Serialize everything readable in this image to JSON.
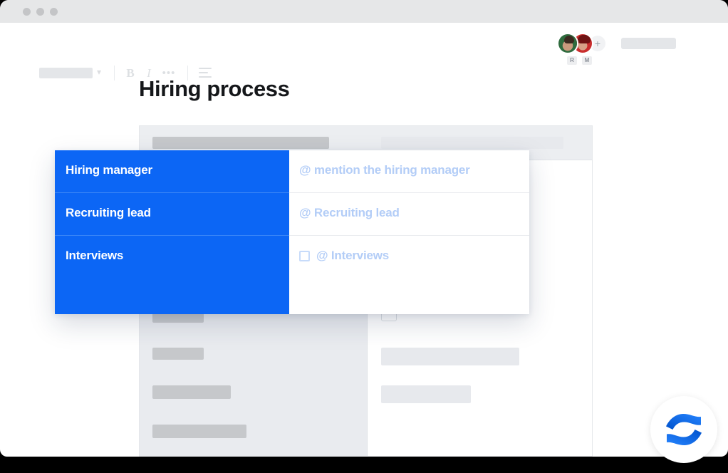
{
  "window": {
    "traffic_lights": [
      "close",
      "minimize",
      "maximize"
    ]
  },
  "toolbar": {
    "style_select_value": "",
    "chevron_icon": "▾",
    "bold_label": "B",
    "italic_label": "I",
    "more_label": "•••",
    "align_icon": "align-left-icon"
  },
  "people": {
    "avatars": [
      {
        "initial": "R",
        "name": "avatar-r"
      },
      {
        "initial": "M",
        "name": "avatar-m"
      }
    ],
    "add_label": "+",
    "share_placeholder_value": ""
  },
  "document": {
    "title": "Hiring process"
  },
  "popup_table": {
    "rows": [
      {
        "label": "Hiring manager",
        "value": "@ mention the hiring manager",
        "checkbox": false
      },
      {
        "label": "Recruiting lead",
        "value": "@ Recruiting lead",
        "checkbox": false
      },
      {
        "label": "Interviews",
        "value": "@ Interviews",
        "checkbox": true
      }
    ]
  },
  "colors": {
    "accent_blue": "#0c66f5",
    "placeholder_blue": "#b3cdf7",
    "titlebar_grey": "#e6e7e8",
    "table_grey": "#e9ebef",
    "bar_dark": "#c6c8cb",
    "bar_light": "#e7e9ed",
    "title_black": "#15171a"
  },
  "branding": {
    "logo": "confluence-logo"
  }
}
